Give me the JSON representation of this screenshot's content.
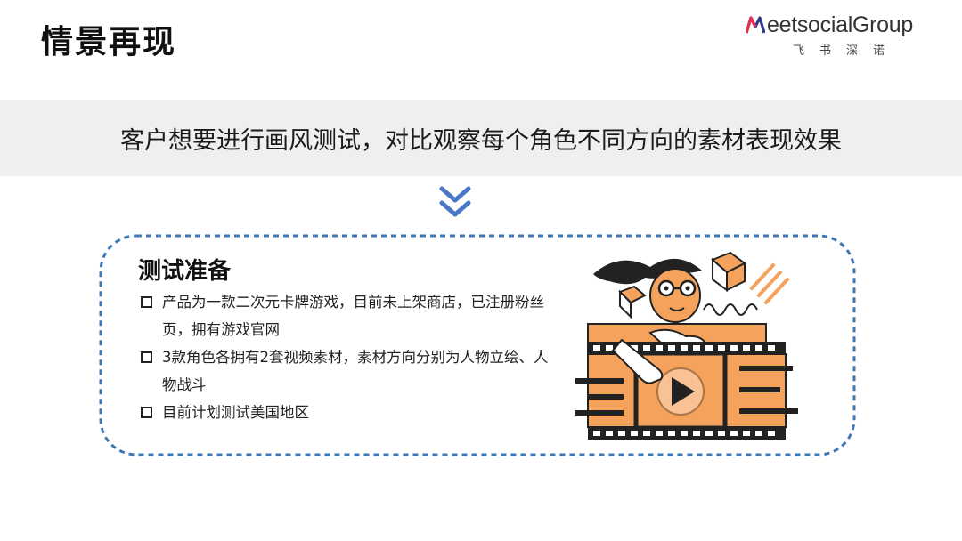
{
  "page": {
    "title": "情景再现"
  },
  "brand": {
    "name_prefix": "M",
    "name_rest": "eetsocial",
    "name_group": "Group",
    "subtitle": "飞书深诺",
    "colors": {
      "red": "#e8304a",
      "blue": "#2b3a8c",
      "text": "#333333"
    }
  },
  "banner": {
    "text": "客户想要进行画风测试，对比观察每个角色不同方向的素材表现效果"
  },
  "prep": {
    "title": "测试准备",
    "items": [
      "产品为一款二次元卡牌游戏，目前未上架商店，已注册粉丝页，拥有游戏官网",
      "3款角色各拥有2套视频素材，素材方向分别为人物立绘、人物战斗",
      "目前计划测试美国地区"
    ]
  },
  "colors": {
    "accent_blue": "#4a77c5",
    "dashed_border": "#3d78b5",
    "banner_bg": "#efefef",
    "illustration_orange": "#f5a25d",
    "illustration_dark": "#222222"
  },
  "icons": [
    "double-chevron-down-icon",
    "checkbox-square-icon",
    "video-play-icon"
  ]
}
